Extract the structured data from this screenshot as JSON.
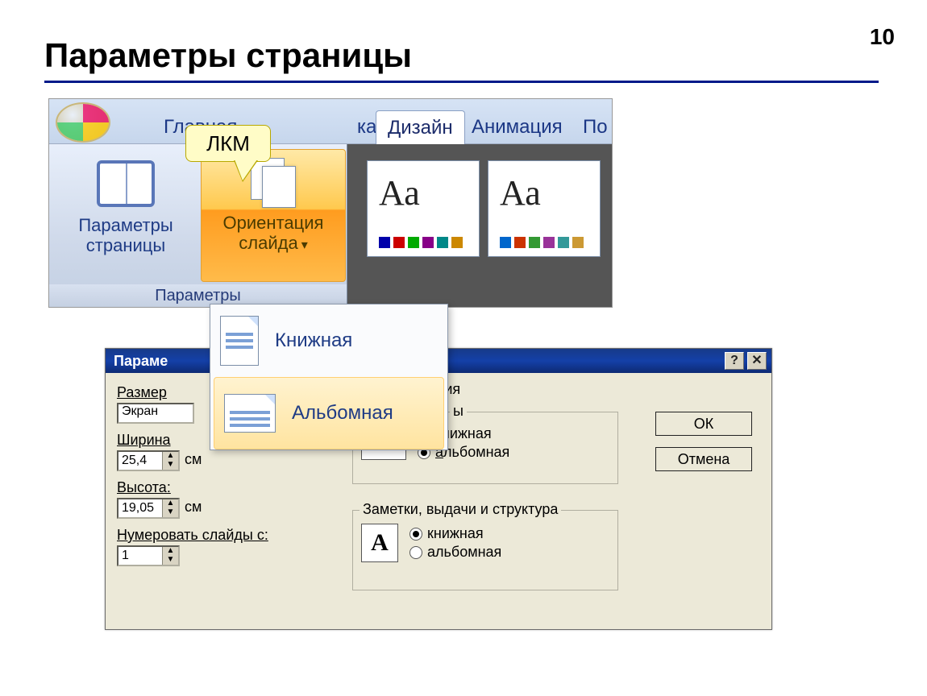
{
  "page": {
    "number": "10",
    "title": "Параметры страницы"
  },
  "callout": {
    "text": "ЛКМ"
  },
  "ribbon": {
    "tabs": {
      "home": "Главная",
      "insert_fragment": "ка",
      "design": "Дизайн",
      "animation": "Анимация",
      "next_fragment": "По"
    },
    "group_label": "Параметры",
    "page_setup_btn": {
      "line1": "Параметры",
      "line2": "страницы"
    },
    "orientation_btn": {
      "line1": "Ориентация",
      "line2": "слайда"
    },
    "theme_sample_text": "Аа"
  },
  "dropdown": {
    "portrait": "Книжная",
    "landscape": "Альбомная"
  },
  "dialog": {
    "title_fragment": "Параме",
    "ok": "ОК",
    "cancel": "Отмена",
    "size_label": "Размер",
    "size_value": "Экран",
    "width_label": "Ширина",
    "width_value": "25,4",
    "height_label": "Высота:",
    "height_value": "19,05",
    "number_from_label": "Нумеровать слайды с:",
    "number_from_value": "1",
    "unit": "см",
    "orientation_section_fragment": "ация",
    "slides_fragment": "ы",
    "radio_portrait": "книжная",
    "radio_landscape": "альбомная",
    "notes_legend": "Заметки, выдачи и структура",
    "icon_letter": "A"
  }
}
